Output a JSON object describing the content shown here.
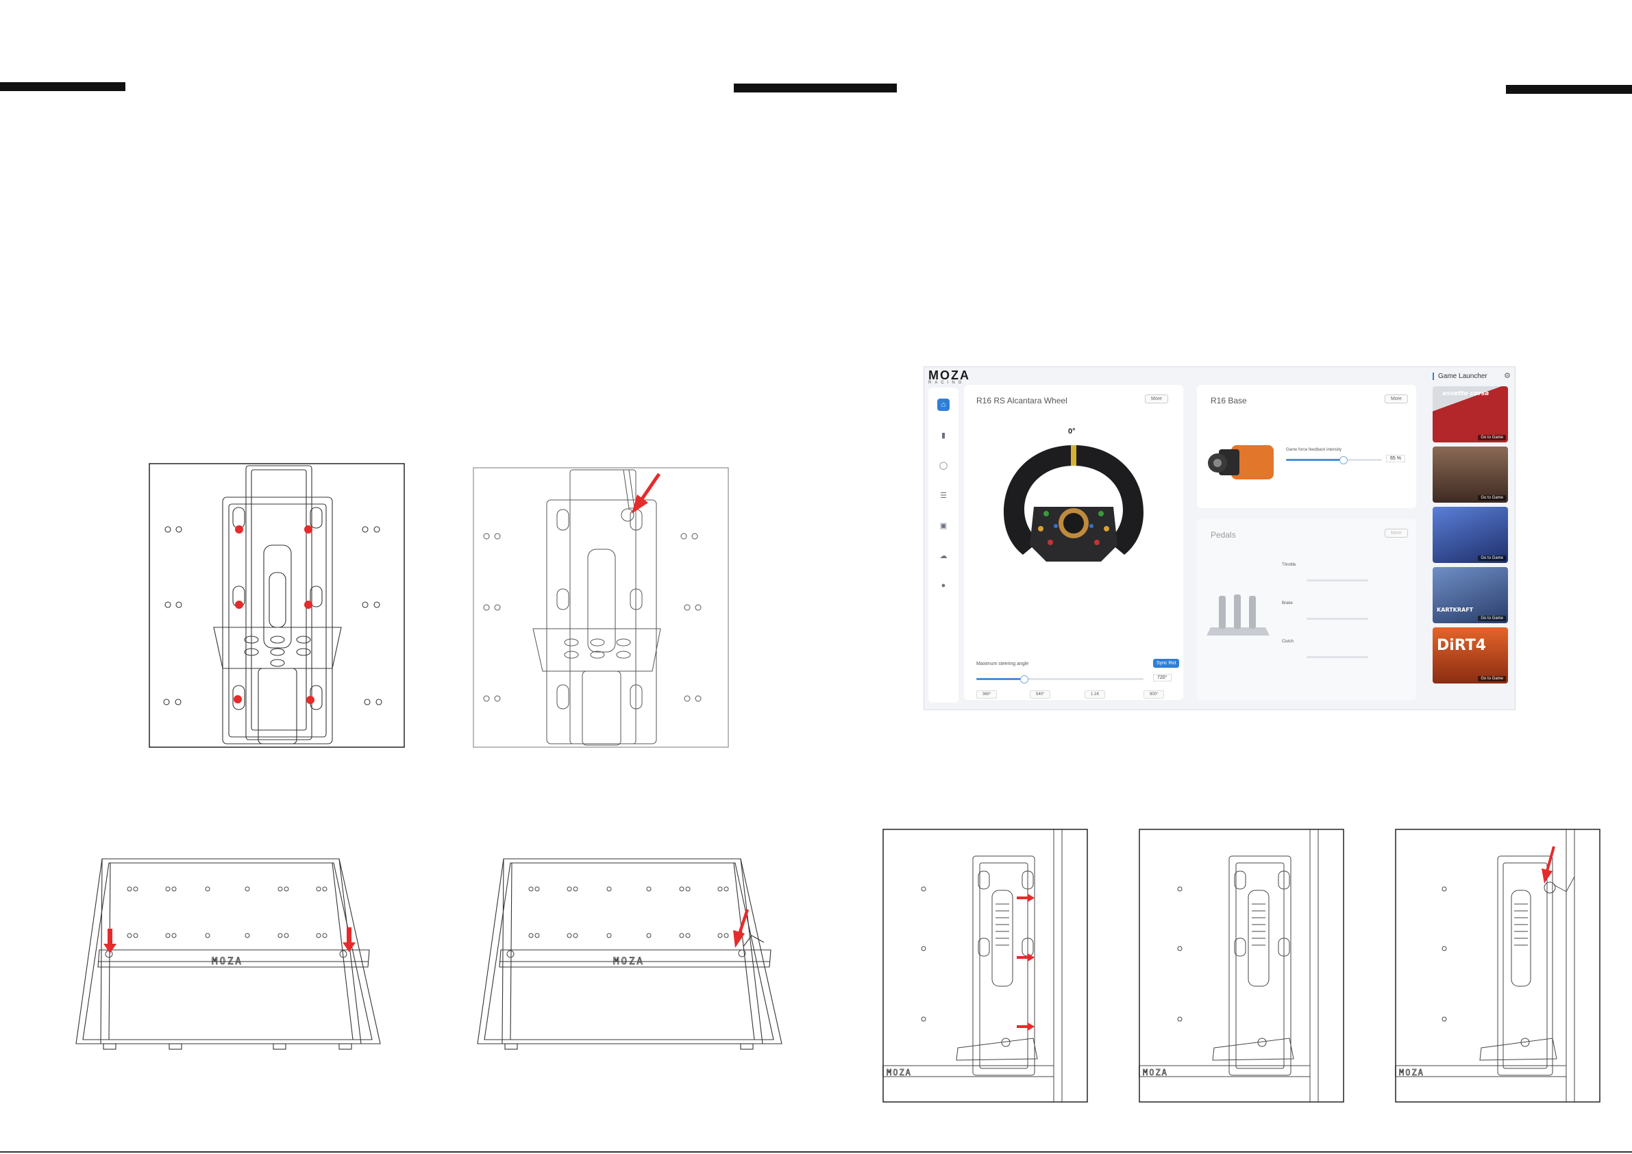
{
  "software": {
    "logo": {
      "word": "MOZA",
      "sub": "RACING"
    },
    "nav_icons": [
      "home-icon",
      "wheel-base-icon",
      "steering-wheel-icon",
      "pedals-icon",
      "dashboard-icon",
      "cloud-icon",
      "user-icon"
    ],
    "wheel_card": {
      "title": "R16 RS Alcantara Wheel",
      "more": "More",
      "angle_display": "0°",
      "slider_label": "Maximum steering angle",
      "sync_button": "Sync Rot",
      "value": "720",
      "value_unit": "°",
      "presets": [
        "360°",
        "540°",
        "1.1K",
        "900°"
      ]
    },
    "base_card": {
      "title": "R16 Base",
      "more": "More",
      "slider_label": "Game force feedback intensity",
      "value": "65",
      "value_unit": "%"
    },
    "pedals_card": {
      "title": "Pedals",
      "more": "More",
      "rows": [
        {
          "label": "Throttle"
        },
        {
          "label": "Brake"
        },
        {
          "label": "Clutch"
        }
      ]
    },
    "game_launcher": {
      "title": "Game Launcher",
      "tiles": [
        {
          "name": "assetto corsa",
          "play": "Go to Game",
          "bg": "#b3262a"
        },
        {
          "name": "",
          "play": "Go to Game",
          "bg": "#6b4b3a"
        },
        {
          "name": "",
          "play": "Go to Game",
          "bg": "#3550a8"
        },
        {
          "name": "KARTKRAFT",
          "play": "Go to Game",
          "bg": "#3a5fa0"
        },
        {
          "name": "DiRT4",
          "play": "Go to Game",
          "bg": "#c8461e"
        }
      ]
    }
  },
  "diagrams": {
    "plate_logo": "MOZA",
    "rail_logo": "MOZA",
    "accent_color": "#e52b2b"
  }
}
